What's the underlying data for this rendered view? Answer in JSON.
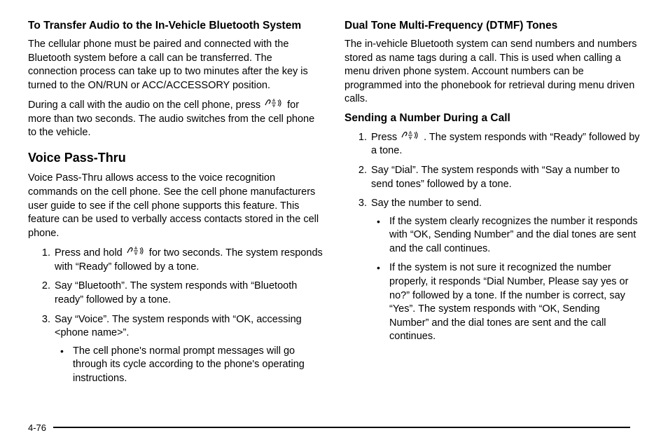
{
  "left": {
    "h1": "To Transfer Audio to the In-Vehicle Bluetooth System",
    "p1": "The cellular phone must be paired and connected with the Bluetooth system before a call can be transferred. The connection process can take up to two minutes after the key is turned to the ON/RUN or ACC/ACCESSORY position.",
    "p2a": "During a call with the audio on the cell phone, press ",
    "p2b": " for more than two seconds. The audio switches from the cell phone to the vehicle.",
    "h2": "Voice Pass-Thru",
    "p3": "Voice Pass-Thru allows access to the voice recognition commands on the cell phone. See the cell phone manufacturers user guide to see if the cell phone supports this feature. This feature can be used to verbally access contacts stored in the cell phone.",
    "ol1a": "Press and hold ",
    "ol1b": " for two seconds. The system responds with “Ready” followed by a tone.",
    "ol2": "Say “Bluetooth”. The system responds with “Bluetooth ready” followed by a tone.",
    "ol3": "Say “Voice”. The system responds with “OK, accessing <phone name>”.",
    "ul1": "The cell phone's normal prompt messages will go through its cycle according to the phone's operating instructions."
  },
  "right": {
    "h1": "Dual Tone Multi-Frequency (DTMF) Tones",
    "p1": "The in-vehicle Bluetooth system can send numbers and numbers stored as name tags during a call. This is used when calling a menu driven phone system. Account numbers can be programmed into the phonebook for retrieval during menu driven calls.",
    "h2": "Sending a Number During a Call",
    "ol1a": "Press ",
    "ol1b": " . The system responds with “Ready” followed by a tone.",
    "ol2": "Say “Dial”. The system responds with “Say a number to send tones” followed by a tone.",
    "ol3": "Say the number to send.",
    "ul1": "If the system clearly recognizes the number it responds with “OK, Sending Number” and the dial tones are sent and the call continues.",
    "ul2": "If the system is not sure it recognized the number properly, it responds “Dial Number, Please say yes or no?” followed by a tone. If the number is correct, say “Yes”. The system responds with “OK, Sending Number” and the dial tones are sent and the call continues."
  },
  "pageNumber": "4-76"
}
